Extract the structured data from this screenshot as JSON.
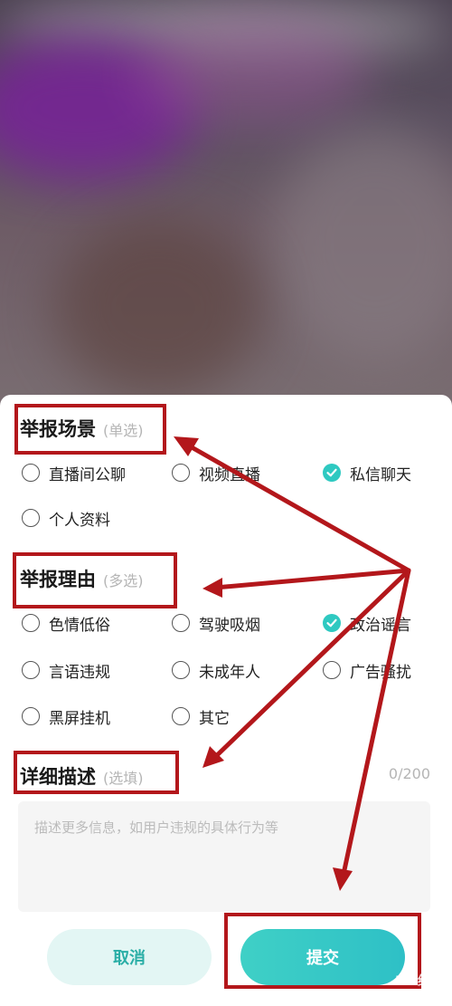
{
  "sheet": {
    "scene_title": "举报场景",
    "scene_hint": "(单选)",
    "scene_options": [
      {
        "label": "直播间公聊",
        "checked": false
      },
      {
        "label": "视频直播",
        "checked": false
      },
      {
        "label": "私信聊天",
        "checked": true
      },
      {
        "label": "个人资料",
        "checked": false
      }
    ],
    "reason_title": "举报理由",
    "reason_hint": "(多选)",
    "reason_options": [
      {
        "label": "色情低俗",
        "checked": false
      },
      {
        "label": "驾驶吸烟",
        "checked": false
      },
      {
        "label": "政治谣言",
        "checked": true
      },
      {
        "label": "言语违规",
        "checked": false
      },
      {
        "label": "未成年人",
        "checked": false
      },
      {
        "label": "广告骚扰",
        "checked": false
      },
      {
        "label": "黑屏挂机",
        "checked": false
      },
      {
        "label": "其它",
        "checked": false
      }
    ],
    "desc_title": "详细描述",
    "desc_hint": "(选填)",
    "desc_counter": "0/200",
    "desc_placeholder": "描述更多信息，如用户违规的具体行为等",
    "cancel_label": "取消",
    "submit_label": "提交"
  },
  "watermark": "Bai经验",
  "colors": {
    "accent": "#2ec9c1",
    "annotation": "#b3171b"
  }
}
